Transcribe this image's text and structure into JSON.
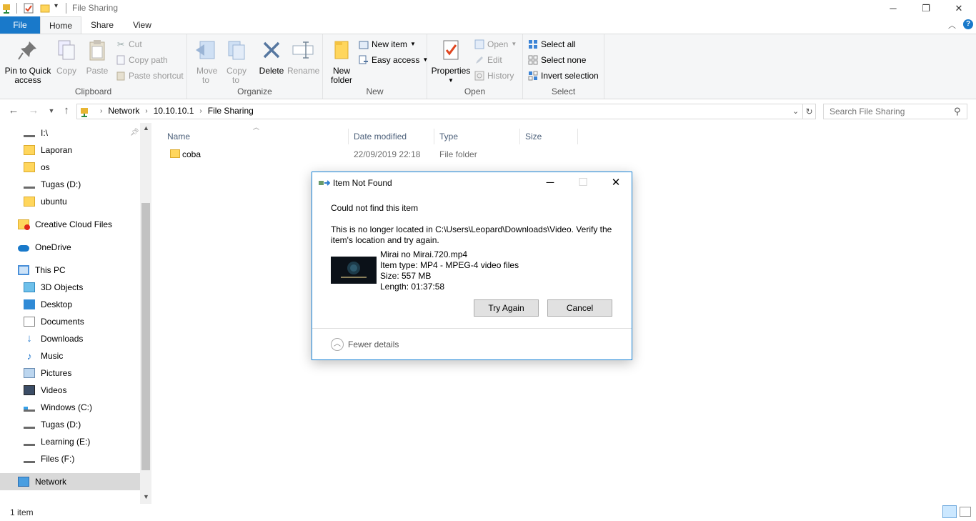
{
  "window": {
    "title": "File Sharing",
    "controls": {
      "minimize": "─",
      "restore": "❐",
      "close": "✕"
    }
  },
  "ribbon": {
    "tabs": [
      "File",
      "Home",
      "Share",
      "View"
    ],
    "clipboard": {
      "label": "Clipboard",
      "pin": "Pin to Quick access",
      "copy": "Copy",
      "paste": "Paste",
      "cut": "Cut",
      "copy_path": "Copy path",
      "paste_shortcut": "Paste shortcut"
    },
    "organize": {
      "label": "Organize",
      "move_to": "Move to",
      "copy_to": "Copy to",
      "delete": "Delete",
      "rename": "Rename"
    },
    "new": {
      "label": "New",
      "new_folder": "New folder",
      "new_item": "New item",
      "easy_access": "Easy access"
    },
    "open": {
      "label": "Open",
      "properties": "Properties",
      "open": "Open",
      "edit": "Edit",
      "history": "History"
    },
    "select": {
      "label": "Select",
      "select_all": "Select all",
      "select_none": "Select none",
      "invert": "Invert selection"
    }
  },
  "address": {
    "crumbs": [
      "Network",
      "10.10.10.1",
      "File Sharing"
    ],
    "search_placeholder": "Search File Sharing"
  },
  "nav": {
    "items": [
      {
        "label": "I:\\",
        "icon": "drive-icon"
      },
      {
        "label": "Laporan",
        "icon": "folder-icon"
      },
      {
        "label": "os",
        "icon": "folder-icon"
      },
      {
        "label": "Tugas (D:)",
        "icon": "drive-icon"
      },
      {
        "label": "ubuntu",
        "icon": "folder-icon"
      },
      {
        "label": "Creative Cloud Files",
        "icon": "creative-cloud-icon"
      },
      {
        "label": "OneDrive",
        "icon": "onedrive-icon"
      },
      {
        "label": "This PC",
        "icon": "pc-icon"
      },
      {
        "label": "3D Objects",
        "icon": "3d-objects-icon"
      },
      {
        "label": "Desktop",
        "icon": "desktop-icon"
      },
      {
        "label": "Documents",
        "icon": "documents-icon"
      },
      {
        "label": "Downloads",
        "icon": "downloads-icon"
      },
      {
        "label": "Music",
        "icon": "music-icon"
      },
      {
        "label": "Pictures",
        "icon": "pictures-icon"
      },
      {
        "label": "Videos",
        "icon": "videos-icon"
      },
      {
        "label": "Windows (C:)",
        "icon": "windows-drive-icon"
      },
      {
        "label": "Tugas (D:)",
        "icon": "drive-icon"
      },
      {
        "label": "Learning (E:)",
        "icon": "drive-icon"
      },
      {
        "label": "Files (F:)",
        "icon": "drive-icon"
      },
      {
        "label": "Network",
        "icon": "network-icon"
      }
    ]
  },
  "files": {
    "columns": [
      "Name",
      "Date modified",
      "Type",
      "Size"
    ],
    "rows": [
      {
        "name": "coba",
        "date": "22/09/2019 22:18",
        "type": "File folder",
        "size": ""
      }
    ]
  },
  "status": {
    "count": "1 item"
  },
  "dialog": {
    "title": "Item Not Found",
    "heading": "Could not find this item",
    "message": "This is no longer located in C:\\Users\\Leopard\\Downloads\\Video. Verify the item's location and try again.",
    "file_name": "Mirai no Mirai.720.mp4",
    "item_type": "Item type: MP4 - MPEG-4 video files",
    "size": "Size: 557 MB",
    "length": "Length: 01:37:58",
    "try_again": "Try Again",
    "cancel": "Cancel",
    "fewer_details": "Fewer details"
  },
  "colors": {
    "accent": "#1979ca",
    "selection": "#cce8ff",
    "folder": "#ffd65c"
  }
}
